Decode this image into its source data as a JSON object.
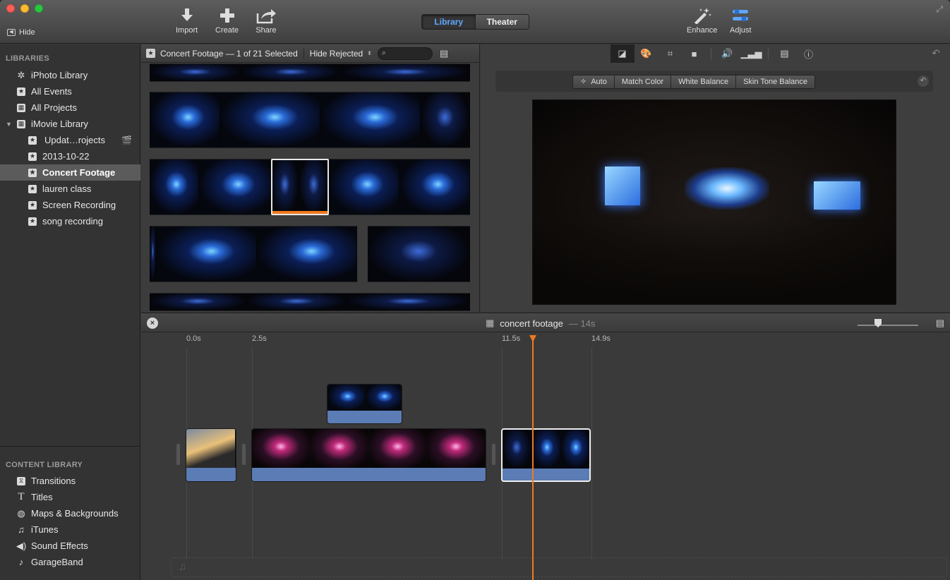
{
  "toolbar": {
    "hide_label": "Hide",
    "import_label": "Import",
    "create_label": "Create",
    "share_label": "Share",
    "library_tab": "Library",
    "theater_tab": "Theater",
    "enhance_label": "Enhance",
    "adjust_label": "Adjust"
  },
  "sidebar": {
    "libraries_header": "LIBRARIES",
    "items": [
      {
        "label": "iPhoto Library",
        "icon": "palm-tree-icon"
      },
      {
        "label": "All Events",
        "icon": "star-icon"
      },
      {
        "label": "All Projects",
        "icon": "grid-icon"
      },
      {
        "label": "iMovie Library",
        "icon": "grid-icon"
      },
      {
        "label": "Updat…rojects",
        "icon": "star-icon"
      },
      {
        "label": "2013-10-22",
        "icon": "star-icon"
      },
      {
        "label": "Concert Footage",
        "icon": "star-icon"
      },
      {
        "label": "lauren class",
        "icon": "star-icon"
      },
      {
        "label": "Screen Recording",
        "icon": "star-icon"
      },
      {
        "label": "song recording",
        "icon": "star-icon"
      }
    ],
    "content_header": "CONTENT LIBRARY",
    "content_items": [
      {
        "label": "Transitions",
        "icon": "transitions-icon"
      },
      {
        "label": "Titles",
        "icon": "titles-icon"
      },
      {
        "label": "Maps & Backgrounds",
        "icon": "globe-icon"
      },
      {
        "label": "iTunes",
        "icon": "music-note-icon"
      },
      {
        "label": "Sound Effects",
        "icon": "speaker-icon"
      },
      {
        "label": "GarageBand",
        "icon": "guitar-icon"
      }
    ]
  },
  "browser": {
    "title": "Concert Footage — 1 of 21 Selected",
    "filter": "Hide Rejected"
  },
  "viewer": {
    "adjust_buttons": [
      "Auto",
      "Match Color",
      "White Balance",
      "Skin Tone Balance"
    ]
  },
  "timeline": {
    "project_name": "concert footage",
    "duration": "— 14s",
    "ticks": [
      "0.0s",
      "2.5s",
      "11.5s",
      "14.9s"
    ]
  },
  "colors": {
    "accent": "#5fa8ff",
    "playhead": "#f07a1e",
    "audio": "#5b7cb4",
    "selection": "#5b5b5b"
  }
}
